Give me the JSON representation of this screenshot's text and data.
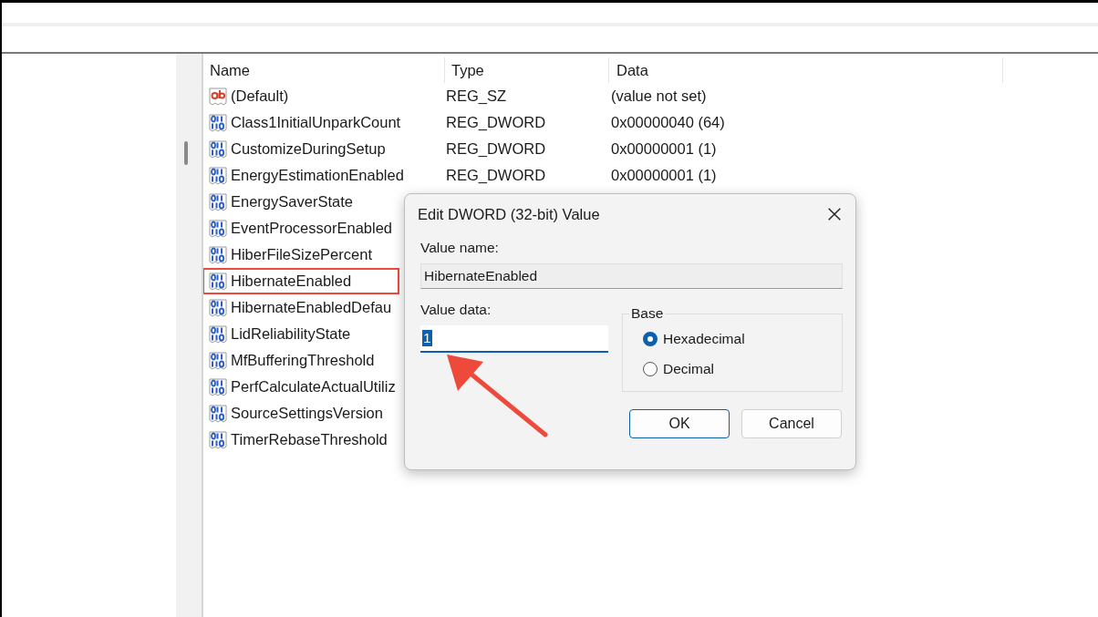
{
  "columns": [
    "Name",
    "Type",
    "Data"
  ],
  "rows": [
    {
      "name": "(Default)",
      "type": "REG_SZ",
      "data": "(value not set)",
      "kind": "string",
      "highlighted": false
    },
    {
      "name": "Class1InitialUnparkCount",
      "type": "REG_DWORD",
      "data": "0x00000040 (64)",
      "kind": "dword",
      "highlighted": false
    },
    {
      "name": "CustomizeDuringSetup",
      "type": "REG_DWORD",
      "data": "0x00000001 (1)",
      "kind": "dword",
      "highlighted": false
    },
    {
      "name": "EnergyEstimationEnabled",
      "type": "REG_DWORD",
      "data": "0x00000001 (1)",
      "kind": "dword",
      "highlighted": false
    },
    {
      "name": "EnergySaverState",
      "kind": "dword",
      "highlighted": false
    },
    {
      "name": "EventProcessorEnabled",
      "kind": "dword",
      "highlighted": false
    },
    {
      "name": "HiberFileSizePercent",
      "kind": "dword",
      "highlighted": false
    },
    {
      "name": "HibernateEnabled",
      "kind": "dword",
      "highlighted": true
    },
    {
      "name": "HibernateEnabledDefau",
      "kind": "dword",
      "highlighted": false
    },
    {
      "name": "LidReliabilityState",
      "kind": "dword",
      "highlighted": false
    },
    {
      "name": "MfBufferingThreshold",
      "kind": "dword",
      "highlighted": false
    },
    {
      "name": "PerfCalculateActualUtiliz",
      "kind": "dword",
      "highlighted": false
    },
    {
      "name": "SourceSettingsVersion",
      "kind": "dword",
      "highlighted": false
    },
    {
      "name": "TimerRebaseThreshold",
      "kind": "dword",
      "highlighted": false
    }
  ],
  "dialog": {
    "title": "Edit DWORD (32-bit) Value",
    "value_name_label": "Value name:",
    "value_name": "HibernateEnabled",
    "value_data_label": "Value data:",
    "value_data": "1",
    "base_label": "Base",
    "base_options": [
      {
        "label": "Hexadecimal",
        "selected": true
      },
      {
        "label": "Decimal",
        "selected": false
      }
    ],
    "buttons": [
      {
        "label": "OK",
        "default": true
      },
      {
        "label": "Cancel",
        "default": false
      }
    ]
  }
}
